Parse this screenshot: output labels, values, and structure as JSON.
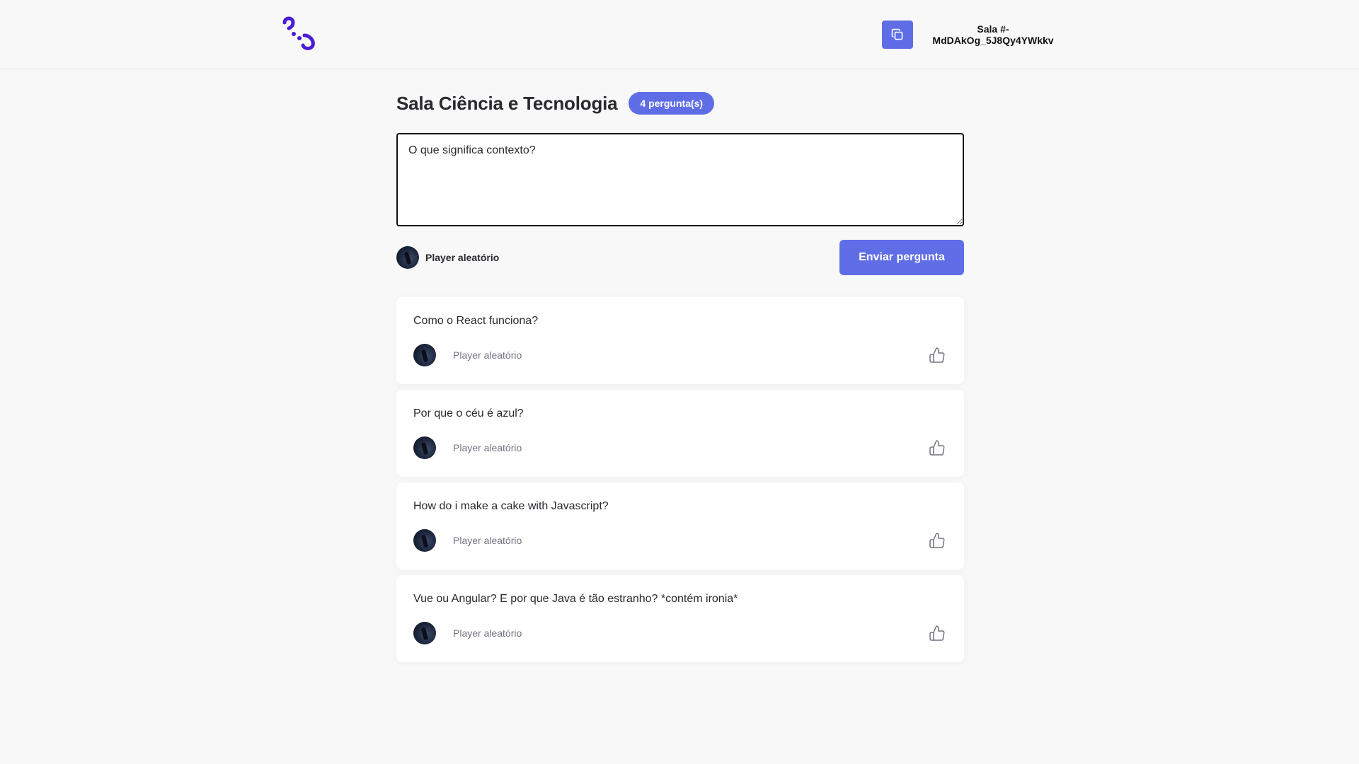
{
  "header": {
    "logo_icon": "letmeask-logo-icon",
    "copy_icon": "copy-icon",
    "room_code_line1": "Sala #-",
    "room_code_line2": "MdDAkOg_5J8Qy4YWkkv"
  },
  "room": {
    "title": "Sala Ciência e Tecnologia",
    "question_count": "4 pergunta(s)"
  },
  "form": {
    "question_value": "O que significa contexto?",
    "user_name": "Player aleatório",
    "submit_label": "Enviar pergunta"
  },
  "colors": {
    "accent": "#5f6ee6",
    "logo": "#4a1bd6",
    "background": "#f8f8f8"
  },
  "questions": [
    {
      "content": "Como o React funciona?",
      "author": "Player aleatório",
      "like_icon": "thumbs-up-icon"
    },
    {
      "content": "Por que o céu é azul?",
      "author": "Player aleatório",
      "like_icon": "thumbs-up-icon"
    },
    {
      "content": "How do i make a cake with Javascript?",
      "author": "Player aleatório",
      "like_icon": "thumbs-up-icon"
    },
    {
      "content": "Vue ou Angular? E por que Java é tão estranho? *contém ironia*",
      "author": "Player aleatório",
      "like_icon": "thumbs-up-icon"
    }
  ]
}
